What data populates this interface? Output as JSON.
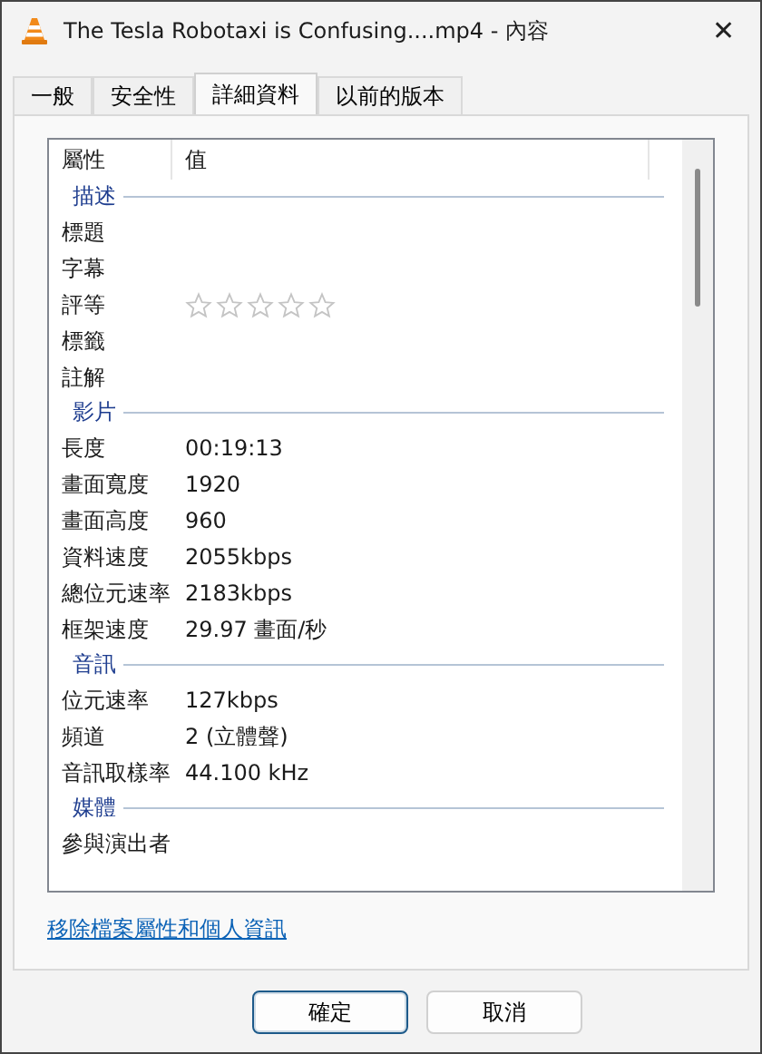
{
  "window": {
    "title": "The Tesla Robotaxi is Confusing....mp4 - 內容",
    "close": "✕"
  },
  "tabs": [
    {
      "label": "一般",
      "selected": false
    },
    {
      "label": "安全性",
      "selected": false
    },
    {
      "label": "詳細資料",
      "selected": true
    },
    {
      "label": "以前的版本",
      "selected": false
    }
  ],
  "table": {
    "columns": [
      "屬性",
      "值"
    ],
    "sections": [
      {
        "title": "描述",
        "rows": [
          {
            "label": "標題",
            "kind": "text"
          },
          {
            "label": "字幕",
            "kind": "text"
          },
          {
            "label": "評等",
            "kind": "stars",
            "stars": 0
          },
          {
            "label": "標籤",
            "kind": "text"
          },
          {
            "label": "註解",
            "kind": "text"
          }
        ]
      },
      {
        "title": "影片",
        "rows": [
          {
            "label": "長度",
            "kind": "text",
            "value": "00:19:13"
          },
          {
            "label": "畫面寬度",
            "kind": "text",
            "value": "1920"
          },
          {
            "label": "畫面高度",
            "kind": "text",
            "value": "960"
          },
          {
            "label": "資料速度",
            "kind": "text",
            "value": "2055kbps"
          },
          {
            "label": "總位元速率",
            "kind": "text",
            "value": "2183kbps"
          },
          {
            "label": "框架速度",
            "kind": "text",
            "value": "29.97 畫面/秒"
          }
        ]
      },
      {
        "title": "音訊",
        "rows": [
          {
            "label": "位元速率",
            "kind": "text",
            "value": "127kbps"
          },
          {
            "label": "頻道",
            "kind": "text",
            "value": "2 (立體聲)"
          },
          {
            "label": "音訊取樣率",
            "kind": "text",
            "value": "44.100 kHz"
          }
        ]
      },
      {
        "title": "媒體",
        "rows": [
          {
            "label": "參與演出者",
            "kind": "text"
          }
        ]
      }
    ]
  },
  "link": "移除檔案屬性和個人資訊",
  "buttons": [
    {
      "label": "確定",
      "default": true
    },
    {
      "label": "取消",
      "default": false
    }
  ]
}
